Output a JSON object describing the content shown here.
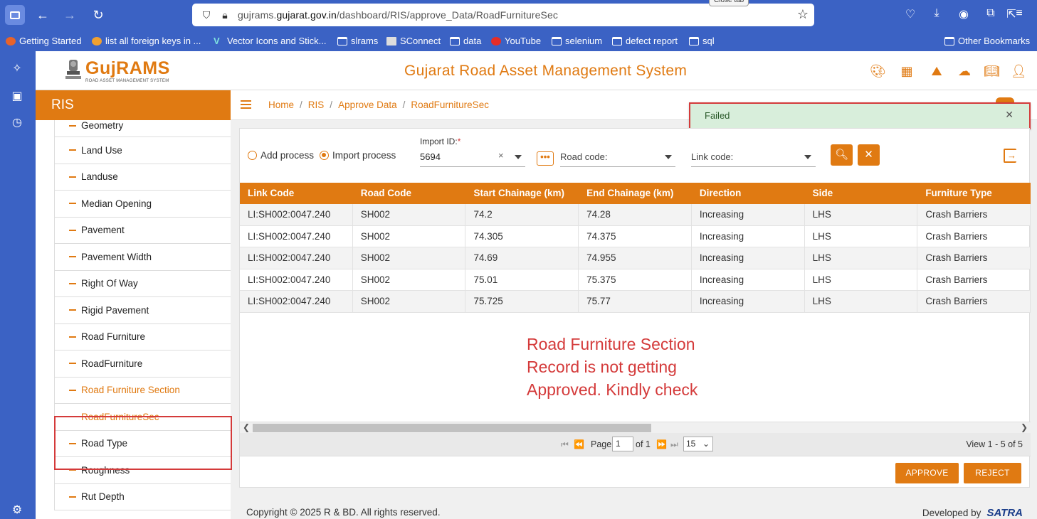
{
  "browser": {
    "url_prefix": "gujrams.",
    "url_domain": "gujarat.gov.in",
    "url_path": "/dashboard/RIS/approve_Data/RoadFurnitureSec",
    "tooltip": "Close tab"
  },
  "bookmarks": [
    {
      "label": "Getting Started",
      "icon": "firefox-icon"
    },
    {
      "label": "list all foreign keys in ...",
      "icon": "stack-icon"
    },
    {
      "label": "Vector Icons and Stick...",
      "icon": "v-icon"
    },
    {
      "label": "slrams",
      "icon": "folder-icon"
    },
    {
      "label": "SConnect",
      "icon": "doc-icon"
    },
    {
      "label": "data",
      "icon": "folder-icon"
    },
    {
      "label": "YouTube",
      "icon": "youtube-icon"
    },
    {
      "label": "selenium",
      "icon": "folder-icon"
    },
    {
      "label": "defect report",
      "icon": "folder-icon"
    },
    {
      "label": "sql",
      "icon": "folder-icon"
    }
  ],
  "other_bookmarks": "Other Bookmarks",
  "app": {
    "logo": "GujRAMS",
    "logo_sub": "ROAD ASSET MANAGEMENT SYSTEM",
    "title": "Gujarat Road Asset Management System",
    "accent": "#e07a12"
  },
  "sidebar": {
    "header": "RIS",
    "items": [
      "Geometry",
      "Land Use",
      "Landuse",
      "Median Opening",
      "Pavement",
      "Pavement Width",
      "Right Of Way",
      "Rigid Pavement",
      "Road Furniture",
      "RoadFurniture",
      "Road Furniture Section",
      "RoadFurnitureSec",
      "Road Type",
      "Roughness",
      "Rut Depth"
    ]
  },
  "breadcrumb": [
    "Home",
    "RIS",
    "Approve Data",
    "RoadFurnitureSec"
  ],
  "toast": {
    "message": "Failed",
    "close": "✕"
  },
  "filters": {
    "add_process": "Add process",
    "import_process": "Import process",
    "import_id_label": "Import ID:",
    "required_mark": "*",
    "import_id_value": "5694",
    "clear": "×",
    "dots": "•••",
    "road_code_label": "Road code:",
    "link_code_label": "Link code:"
  },
  "table": {
    "columns": [
      "Link Code",
      "Road Code",
      "Start Chainage (km)",
      "End Chainage (km)",
      "Direction",
      "Side",
      "Furniture Type"
    ],
    "rows": [
      [
        "LI:SH002:0047.240",
        "SH002",
        "74.2",
        "74.28",
        "Increasing",
        "LHS",
        "Crash Barriers"
      ],
      [
        "LI:SH002:0047.240",
        "SH002",
        "74.305",
        "74.375",
        "Increasing",
        "LHS",
        "Crash Barriers"
      ],
      [
        "LI:SH002:0047.240",
        "SH002",
        "74.69",
        "74.955",
        "Increasing",
        "LHS",
        "Crash Barriers"
      ],
      [
        "LI:SH002:0047.240",
        "SH002",
        "75.01",
        "75.375",
        "Increasing",
        "LHS",
        "Crash Barriers"
      ],
      [
        "LI:SH002:0047.240",
        "SH002",
        "75.725",
        "75.77",
        "Increasing",
        "LHS",
        "Crash Barriers"
      ]
    ]
  },
  "annotation": [
    "Road Furniture Section",
    "Record is not getting",
    "Approved. Kindly check"
  ],
  "pager": {
    "page_label": "Page",
    "page_value": "1",
    "of_label": "of 1",
    "page_size": "15",
    "view_text": "View 1 - 5 of 5"
  },
  "actions": {
    "approve": "APPROVE",
    "reject": "REJECT"
  },
  "footer": {
    "copyright": "Copyright © 2025 R & BD. All rights reserved.",
    "developed_by": "Developed by",
    "brand": "SATRA"
  }
}
